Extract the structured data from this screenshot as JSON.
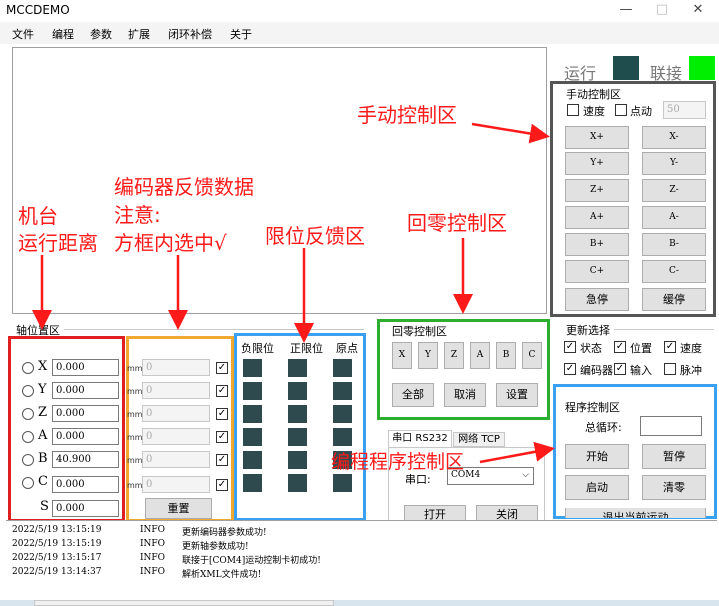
{
  "window": {
    "title": "MCCDEMO",
    "minimize_glyph": "—",
    "maximize_glyph": "□",
    "close_glyph": "✕"
  },
  "menu": [
    "文件",
    "编程",
    "参数",
    "扩展",
    "闭环补偿",
    "关于"
  ],
  "status": {
    "run_label": "运行",
    "connect_label": "联接",
    "run_color": "#1f4d4d",
    "connect_color": "#00ee00"
  },
  "manual": {
    "title": "手动控制区",
    "speed_label": "速度",
    "jog_label": "点动",
    "jog_value": "50",
    "buttons": [
      [
        "X+",
        "X-"
      ],
      [
        "Y+",
        "Y-"
      ],
      [
        "Z+",
        "Z-"
      ],
      [
        "A+",
        "A-"
      ],
      [
        "B+",
        "B-"
      ],
      [
        "C+",
        "C-"
      ],
      [
        "急停",
        "缓停"
      ]
    ]
  },
  "axis_panel": {
    "title": "轴位置区",
    "axes": [
      {
        "letter": "X",
        "value": "0.000",
        "unit": "mm",
        "encoder": "0",
        "checked": true
      },
      {
        "letter": "Y",
        "value": "0.000",
        "unit": "mm",
        "encoder": "0",
        "checked": true
      },
      {
        "letter": "Z",
        "value": "0.000",
        "unit": "mm",
        "encoder": "0",
        "checked": true
      },
      {
        "letter": "A",
        "value": "0.000",
        "unit": "mm",
        "encoder": "0",
        "checked": true
      },
      {
        "letter": "B",
        "value": "40.900",
        "unit": "mm",
        "encoder": "0",
        "checked": true
      },
      {
        "letter": "C",
        "value": "0.000",
        "unit": "mm",
        "encoder": "0",
        "checked": true
      }
    ],
    "s_label": "S",
    "s_value": "0.000",
    "reset_label": "重置"
  },
  "limits": {
    "neg_label": "负限位",
    "pos_label": "正限位",
    "home_label": "原点"
  },
  "homing": {
    "title": "回零控制区",
    "axes": [
      "X",
      "Y",
      "Z",
      "A",
      "B",
      "C"
    ],
    "all_label": "全部",
    "cancel_label": "取消",
    "settings_label": "设置"
  },
  "comm": {
    "tabs": [
      "串口 RS232",
      "网络 TCP"
    ],
    "port_label": "串口:",
    "port_value": "COM4",
    "open_label": "打开",
    "close_label": "关闭"
  },
  "update": {
    "title": "更新选择",
    "items": [
      {
        "label": "状态",
        "checked": true
      },
      {
        "label": "位置",
        "checked": true
      },
      {
        "label": "速度",
        "checked": true
      },
      {
        "label": "编码器",
        "checked": true
      },
      {
        "label": "输入",
        "checked": true
      },
      {
        "label": "脉冲",
        "checked": false
      }
    ]
  },
  "program": {
    "title": "程序控制区",
    "loop_label": "总循环:",
    "loop_value": "",
    "start_label": "开始",
    "pause_label": "暂停",
    "launch_label": "启动",
    "clear_label": "清零",
    "exit_label": "退出当前运动"
  },
  "log": [
    {
      "time": "2022/5/19 13:15:19",
      "level": "INFO",
      "msg": "更新编码器参数成功!"
    },
    {
      "time": "2022/5/19 13:15:19",
      "level": "INFO",
      "msg": "更新轴参数成功!"
    },
    {
      "time": "2022/5/19 13:15:17",
      "level": "INFO",
      "msg": "联接于[COM4]运动控制卡初成功!"
    },
    {
      "time": "2022/5/19 13:14:37",
      "level": "INFO",
      "msg": "解析XML文件成功!"
    }
  ],
  "annotations": {
    "manual_zone": "手动控制区",
    "machine_line1": "机台",
    "machine_line2": "运行距离",
    "encoder_line1": "编码器反馈数据",
    "encoder_line2": "注意:",
    "encoder_line3": "方框内选中√",
    "limit_zone": "限位反馈区",
    "homing_zone": "回零控制区",
    "program_zone": "编程程序控制区",
    "arrow_color": "#ff1a1a"
  }
}
